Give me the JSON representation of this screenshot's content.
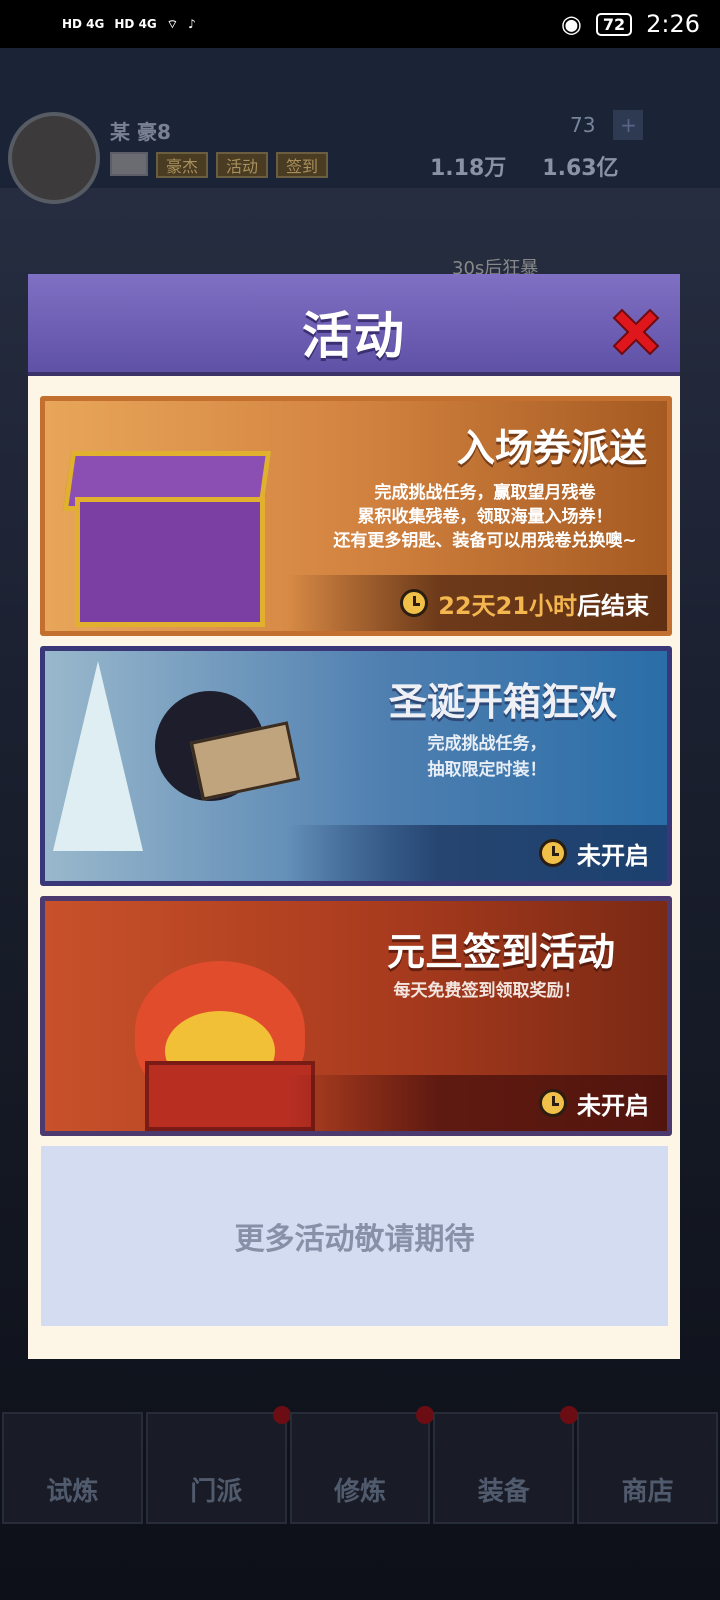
{
  "status_bar": {
    "sim1": "HD 4G",
    "sim2": "HD 4G",
    "battery": "72",
    "time": "2:26"
  },
  "background": {
    "player_name": "某 豪8",
    "hud_buttons": [
      "豪杰",
      "活动",
      "签到"
    ],
    "gem_count": "73",
    "ticket_count": "1.18万",
    "coin_count": "1.63亿",
    "timer_text": "30s后狂暴"
  },
  "modal": {
    "title": "活动",
    "cards": [
      {
        "title": "入场券派送",
        "desc": [
          "完成挑战任务，赢取望月残卷",
          "累积收集残卷，领取海量入场券！",
          "还有更多钥匙、装备可以用残卷兑换噢~"
        ],
        "status_highlight": "22天21小时",
        "status_suffix": "后结束"
      },
      {
        "title": "圣诞开箱狂欢",
        "desc": [
          "完成挑战任务，",
          "抽取限定时装！"
        ],
        "status_highlight": "",
        "status_suffix": "未开启"
      },
      {
        "title": "元旦签到活动",
        "desc": [
          "每天免费签到领取奖励！"
        ],
        "status_highlight": "",
        "status_suffix": "未开启"
      }
    ],
    "more_text": "更多活动敬请期待"
  },
  "bottom_nav": {
    "items": [
      "试炼",
      "门派",
      "修炼",
      "装备",
      "商店"
    ]
  },
  "colors": {
    "modal_header": "#6e5fb5",
    "modal_body": "#fdf5e6",
    "highlight": "#f4b64e",
    "close_red": "#e0161d"
  },
  "icons": {
    "close": "close-x-icon",
    "clock": "clock-icon"
  }
}
